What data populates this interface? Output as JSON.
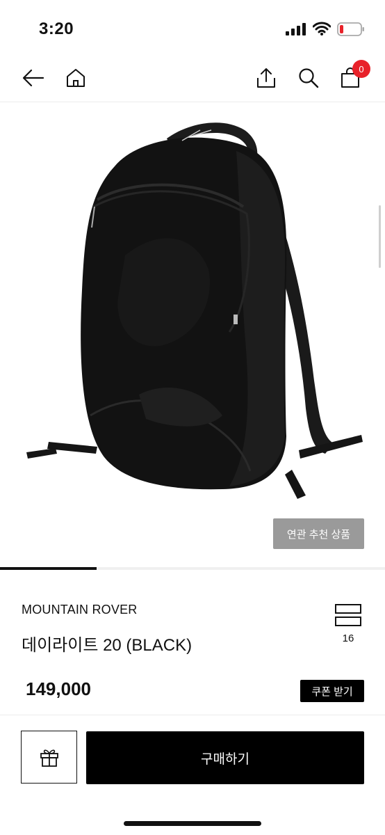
{
  "status_bar": {
    "time": "3:20",
    "battery_color": "#e8222a"
  },
  "nav": {
    "back_icon": "arrow-left-icon",
    "home_icon": "home-icon",
    "share_icon": "share-icon",
    "search_icon": "search-icon",
    "cart_icon": "shopping-bag-icon",
    "cart_count": "0",
    "badge_color": "#e8222a"
  },
  "gallery": {
    "image_alt": "black backpack product photo",
    "related_label": "연관 추천 상품",
    "slide_progress": 0.25
  },
  "product": {
    "brand": "MOUNTAIN ROVER",
    "name": "데이라이트 20 (BLACK)",
    "compare_count": "16",
    "price": "149,000",
    "coupon_label": "쿠폰 받기"
  },
  "actions": {
    "gift_icon": "gift-icon",
    "buy_label": "구매하기"
  }
}
